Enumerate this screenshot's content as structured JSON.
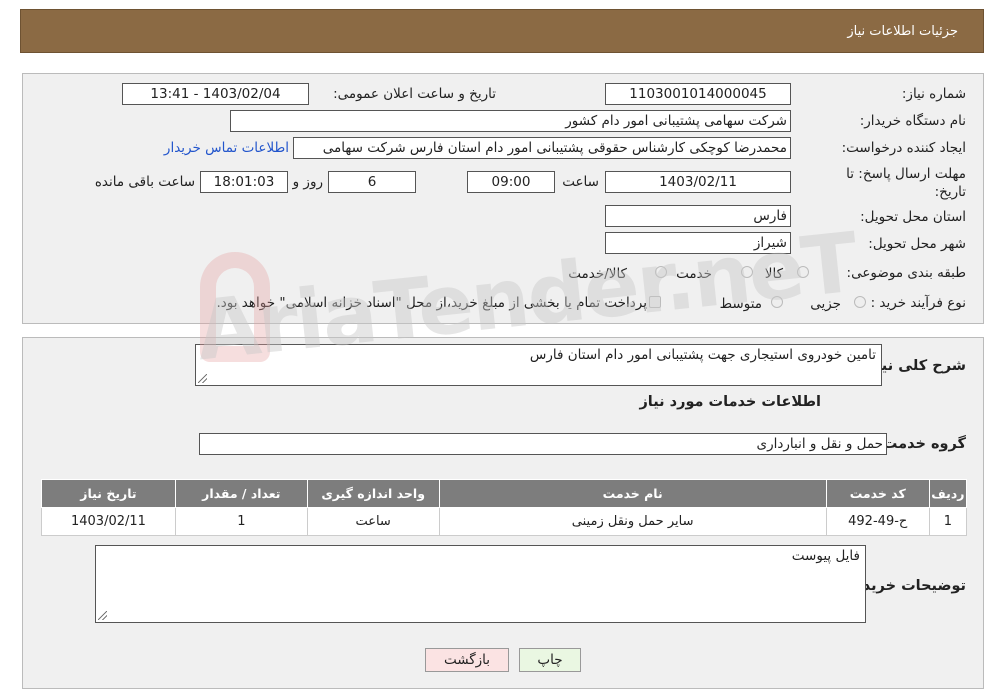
{
  "header": {
    "title": "جزئیات اطلاعات نیاز"
  },
  "form": {
    "need_number": {
      "label": "شماره نیاز:",
      "value": "1103001014000045"
    },
    "announce_datetime": {
      "label": "تاریخ و ساعت اعلان عمومی:",
      "value": "1403/02/04 - 13:41"
    },
    "buyer_org": {
      "label": "نام دستگاه خریدار:",
      "value": "شرکت سهامی پشتیبانی امور دام کشور"
    },
    "requester": {
      "label": "ایجاد کننده درخواست:",
      "value": "محمدرضا کوچکی کارشناس حقوقی پشتیبانی امور دام استان فارس شرکت سهامی",
      "contact_link": "اطلاعات تماس خریدار"
    },
    "deadline": {
      "label": "مهلت ارسال پاسخ: تا تاریخ:",
      "date": "1403/02/11",
      "time_label": "ساعت",
      "time": "09:00",
      "days": "6",
      "days_label": "روز و",
      "remaining": "18:01:03",
      "remaining_label": "ساعت باقی مانده"
    },
    "province": {
      "label": "استان محل تحویل:",
      "value": "فارس"
    },
    "city": {
      "label": "شهر محل تحویل:",
      "value": "شیراز"
    },
    "category": {
      "label": "طبقه بندی موضوعی:",
      "options": [
        "کالا",
        "خدمت",
        "کالا/خدمت"
      ]
    },
    "purchase_type": {
      "label": "نوع فرآیند خرید :",
      "options": [
        "جزیی",
        "متوسط"
      ],
      "note": "پرداخت تمام یا بخشی از مبلغ خرید،از محل \"اسناد خزانه اسلامی\" خواهد بود."
    }
  },
  "details": {
    "summary_label": "شرح کلی نیاز:",
    "summary_value": "تامین خودروی استیجاری جهت پشتیبانی امور دام استان فارس",
    "services_title": "اطلاعات خدمات مورد نیاز",
    "service_group_label": "گروه خدمت:",
    "service_group_value": "حمل و نقل و انبارداری",
    "table": {
      "headers": [
        "ردیف",
        "کد خدمت",
        "نام خدمت",
        "واحد اندازه گیری",
        "تعداد / مقدار",
        "تاریخ نیاز"
      ],
      "rows": [
        [
          "1",
          "ح-49-492",
          "سایر حمل ونقل زمینی",
          "ساعت",
          "1",
          "1403/02/11"
        ]
      ]
    },
    "buyer_notes_label": "توضیحات خریدار:",
    "buyer_notes_value": "فایل پیوست"
  },
  "buttons": {
    "print": "چاپ",
    "back": "بازگشت"
  },
  "watermark": {
    "text": "AriaTender.neT"
  }
}
